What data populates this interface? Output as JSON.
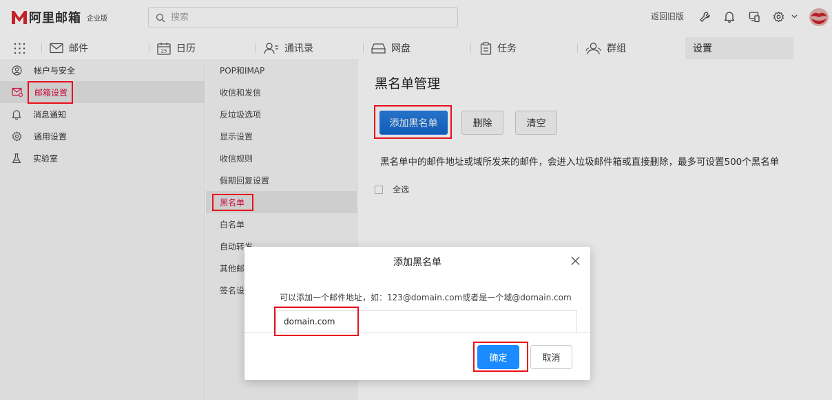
{
  "app": {
    "logo_text": "阿里邮箱",
    "edition": "企业版",
    "brand_color": "#d9262e",
    "accent_color": "#1a73e8"
  },
  "search": {
    "placeholder": "搜索",
    "icon": "search-icon"
  },
  "header_actions": {
    "back_old": "返回旧版",
    "icons": [
      "wrench-icon",
      "bell-icon",
      "devices-icon",
      "gear-icon",
      "chevron-down-icon",
      "avatar"
    ]
  },
  "nav": {
    "tabs": [
      {
        "label": "邮件",
        "icon": "mail-icon"
      },
      {
        "label": "日历",
        "icon": "calendar-icon",
        "icon_text": "25"
      },
      {
        "label": "通讯录",
        "icon": "contacts-icon"
      },
      {
        "label": "网盘",
        "icon": "disk-icon"
      },
      {
        "label": "任务",
        "icon": "clipboard-icon"
      },
      {
        "label": "群组",
        "icon": "group-icon"
      },
      {
        "label": "设置",
        "active": true
      }
    ]
  },
  "sidebar": {
    "items": [
      {
        "label": "帐户与安全",
        "icon": "user-icon"
      },
      {
        "label": "邮箱设置",
        "icon": "mail-settings-icon",
        "active": true
      },
      {
        "label": "消息通知",
        "icon": "bell-icon"
      },
      {
        "label": "通用设置",
        "icon": "gear-icon"
      },
      {
        "label": "实验室",
        "icon": "flask-icon"
      }
    ]
  },
  "submenu": {
    "items": [
      {
        "label": "POP和IMAP"
      },
      {
        "label": "收信和发信"
      },
      {
        "label": "反垃圾选项"
      },
      {
        "label": "显示设置"
      },
      {
        "label": "收信规则"
      },
      {
        "label": "假期回复设置"
      },
      {
        "label": "黑名单",
        "active": true
      },
      {
        "label": "白名单"
      },
      {
        "label": "自动转发"
      },
      {
        "label": "其他邮"
      },
      {
        "label": "签名设"
      }
    ]
  },
  "main": {
    "title": "黑名单管理",
    "add_label": "添加黑名单",
    "delete_label": "删除",
    "clear_label": "清空",
    "description": "黑名单中的邮件地址或域所发来的邮件，会进入垃圾邮件箱或直接删除，最多可设置500个黑名单",
    "select_all": "全选"
  },
  "modal": {
    "title": "添加黑名单",
    "hint": "可以添加一个邮件地址，如：123@domain.com或者是一个域@domain.com",
    "input_value": "domain.com",
    "ok_label": "确定",
    "cancel_label": "取消"
  }
}
